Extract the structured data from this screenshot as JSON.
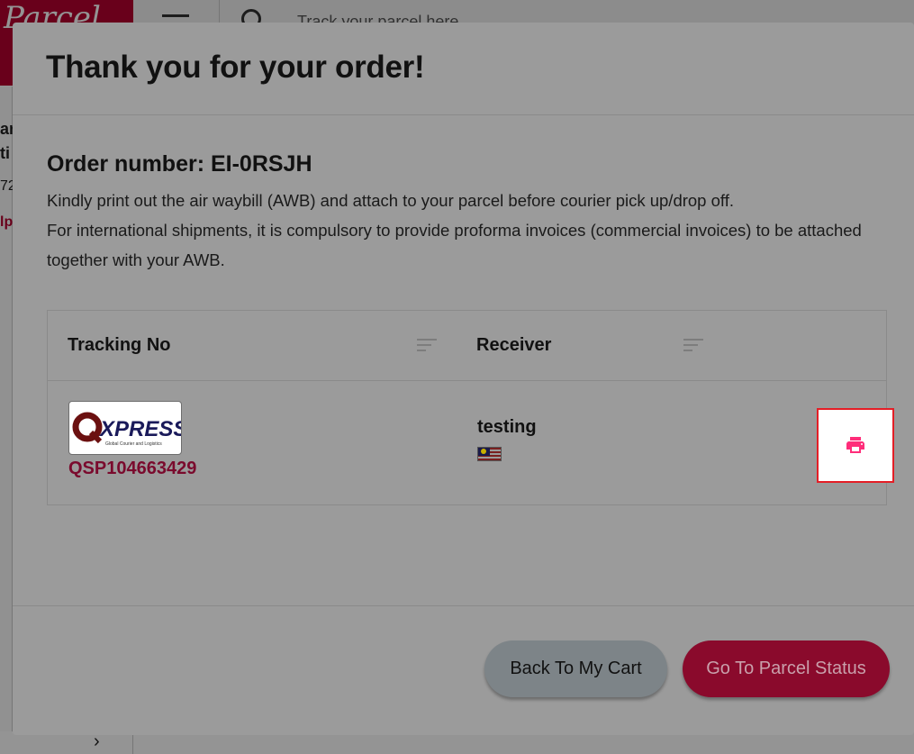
{
  "background": {
    "logo_text": "Parcel",
    "search_placeholder": "Track your parcel here",
    "left_fragments": [
      "ar",
      "ti",
      "72",
      "lp"
    ]
  },
  "modal": {
    "title": "Thank you for your order!",
    "order_number": "Order number: EI-0RSJH",
    "instruction_line1": "Kindly print out the air waybill (AWB) and attach to your parcel before courier pick up/drop off.",
    "instruction_line2": "For international shipments, it is compulsory to provide proforma invoices (commercial invoices) to be attached together with your AWB."
  },
  "table": {
    "headers": [
      "Tracking No",
      "Receiver"
    ],
    "rows": [
      {
        "courier_logo_text": "XPRESS",
        "courier_logo_prefix": "Q",
        "courier_logo_sub": "Global Courier and Logistics",
        "tracking_no": "QSP104663429",
        "receiver": "testing",
        "receiver_flag": "malaysia-flag"
      }
    ]
  },
  "buttons": {
    "back": "Back To My Cart",
    "status": "Go To Parcel Status"
  },
  "icons": {
    "print": "print-icon",
    "sort": "sort-icon"
  },
  "colors": {
    "brand": "#b5002f",
    "print_icon": "#ff2d7a",
    "highlight_border": "#e41e26"
  }
}
